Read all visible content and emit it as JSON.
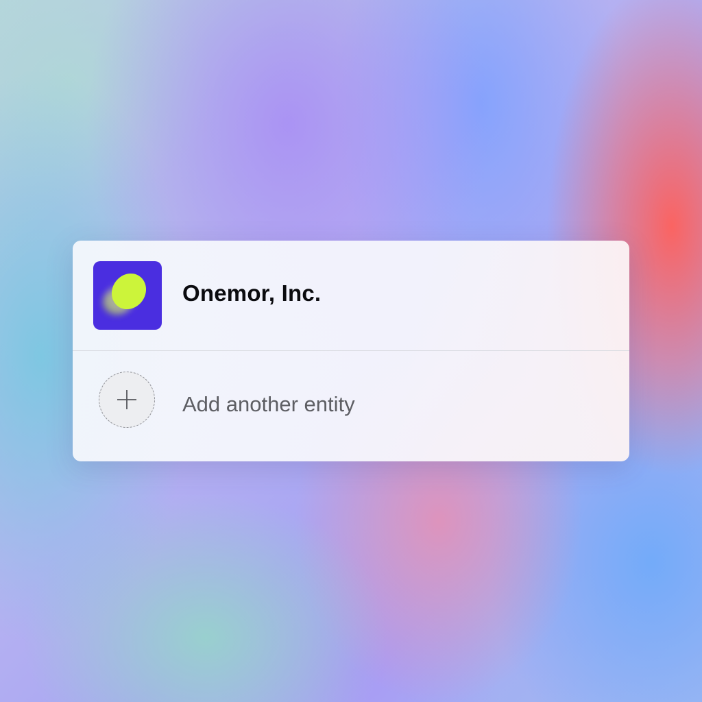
{
  "entities": [
    {
      "name": "Onemor, Inc.",
      "logo_icon": "onemor-logo-icon",
      "logo_bg": "#4a2ee0",
      "logo_accent": "#ccf43a"
    }
  ],
  "add_entity": {
    "label": "Add another entity",
    "icon": "plus-icon"
  }
}
